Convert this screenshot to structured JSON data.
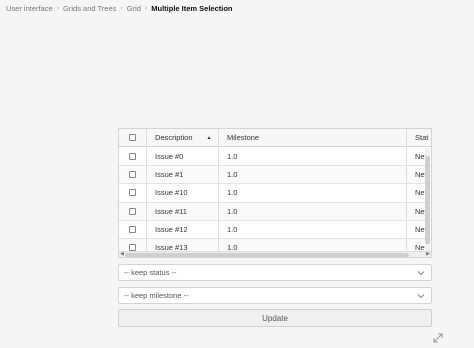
{
  "breadcrumb": {
    "items": [
      "User interface",
      "Grids and Trees",
      "Grid"
    ],
    "current": "Multiple Item Selection",
    "separator": "›"
  },
  "grid": {
    "columns": {
      "description": "Description",
      "milestone": "Milestone",
      "status": "Stat"
    },
    "sort_icon": "sort-ascending-icon",
    "rows": [
      {
        "description": "Issue #0",
        "milestone": "1.0",
        "status": "Nev"
      },
      {
        "description": "Issue #1",
        "milestone": "1.0",
        "status": "Nev"
      },
      {
        "description": "Issue #10",
        "milestone": "1.0",
        "status": "Nev"
      },
      {
        "description": "Issue #11",
        "milestone": "1.0",
        "status": "Nev"
      },
      {
        "description": "Issue #12",
        "milestone": "1.0",
        "status": "Nev"
      },
      {
        "description": "Issue #13",
        "milestone": "1.0",
        "status": "Nev"
      }
    ]
  },
  "status_select": {
    "value": "-- keep status --"
  },
  "milestone_select": {
    "value": "-- keep milestone --"
  },
  "update_button": {
    "label": "Update"
  }
}
